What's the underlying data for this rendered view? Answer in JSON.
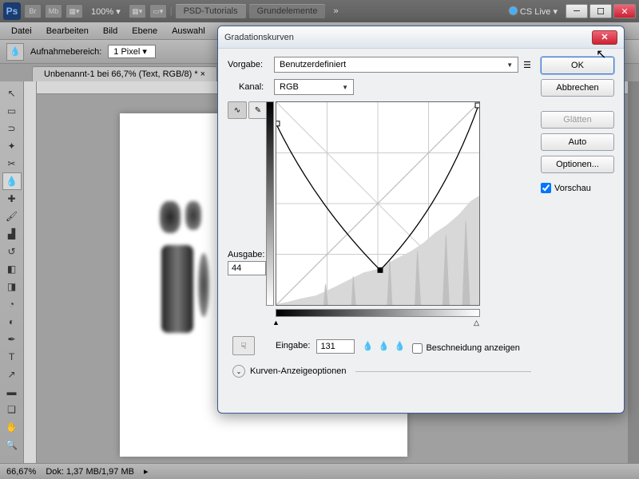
{
  "titlebar": {
    "ps": "Ps",
    "br": "Br",
    "mb": "Mb",
    "zoom": "100%",
    "tabs": [
      "PSD-Tutorials",
      "Grundelemente"
    ],
    "more": "»",
    "cslive": "CS Live ▾"
  },
  "menu": [
    "Datei",
    "Bearbeiten",
    "Bild",
    "Ebene",
    "Auswahl"
  ],
  "optbar": {
    "label": "Aufnahmebereich:",
    "value": "1 Pixel"
  },
  "doctab": "Unbenannt-1 bei 66,7% (Text, RGB/8) * ×",
  "status": {
    "zoom": "66,67%",
    "dok": "Dok: 1,37 MB/1,97 MB"
  },
  "dialog": {
    "title": "Gradationskurven",
    "preset_lbl": "Vorgabe:",
    "preset_val": "Benutzerdefiniert",
    "channel_lbl": "Kanal:",
    "channel_val": "RGB",
    "output_lbl": "Ausgabe:",
    "output_val": "44",
    "input_lbl": "Eingabe:",
    "input_val": "131",
    "clip_lbl": "Beschneidung anzeigen",
    "opts_lbl": "Kurven-Anzeigeoptionen",
    "btn_ok": "OK",
    "btn_cancel": "Abbrechen",
    "btn_smooth": "Glätten",
    "btn_auto": "Auto",
    "btn_options": "Optionen...",
    "preview_lbl": "Vorschau"
  },
  "chart_data": {
    "type": "line",
    "title": "Gradationskurven",
    "xlabel": "Eingabe",
    "ylabel": "Ausgabe",
    "xlim": [
      0,
      255
    ],
    "ylim": [
      0,
      255
    ],
    "series": [
      {
        "name": "curve",
        "x": [
          0,
          40,
          80,
          131,
          180,
          220,
          255
        ],
        "y": [
          228,
          145,
          75,
          44,
          85,
          170,
          252
        ]
      },
      {
        "name": "baseline",
        "x": [
          0,
          255
        ],
        "y": [
          0,
          255
        ]
      }
    ],
    "control_point": {
      "x": 131,
      "y": 44
    }
  }
}
